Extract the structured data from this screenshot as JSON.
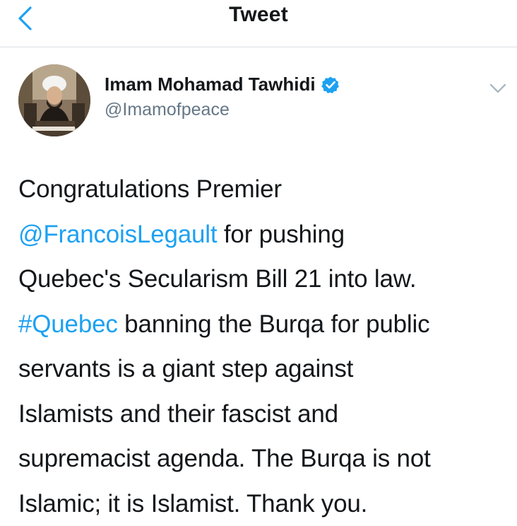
{
  "nav": {
    "title": "Tweet"
  },
  "author": {
    "display_name": "Imam Mohamad Tawhidi",
    "handle": "@Imamofpeace",
    "verified": true
  },
  "tweet": {
    "line1": "Congratulations Premier",
    "mention": "@FrancoisLegault",
    "line2_rest": " for pushing",
    "line3": "Quebec's Secularism Bill 21 into law.",
    "hashtag": "#Quebec",
    "line4_rest": " banning the Burqa for public",
    "line5": "servants is a giant step against",
    "line6": "Islamists and their fascist and",
    "line7": "supremacist agenda. The Burqa is not",
    "line8": "Islamic; it is Islamist. Thank you."
  },
  "colors": {
    "accent": "#1da1f2",
    "text": "#14171a",
    "secondary": "#657786",
    "divider": "#d8dde2"
  },
  "icons": {
    "back": "chevron-left-icon",
    "verified": "verified-badge-icon",
    "more": "chevron-down-icon"
  }
}
